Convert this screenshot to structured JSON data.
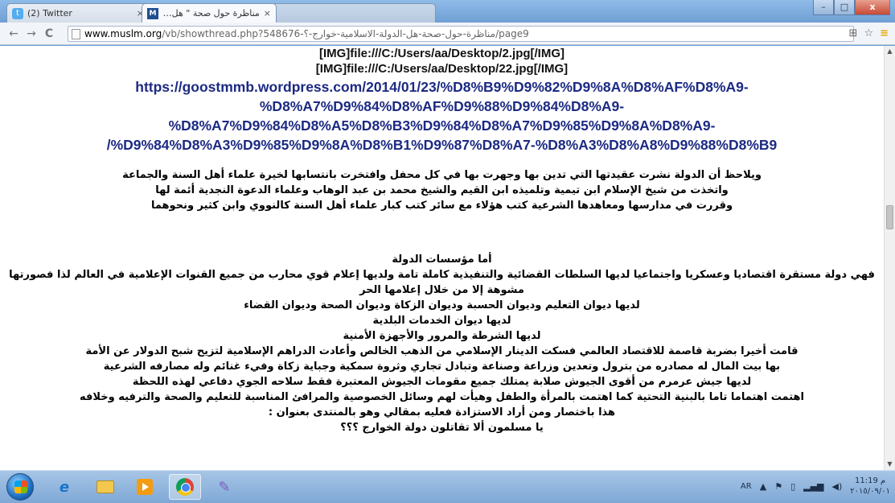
{
  "tabs": [
    {
      "title": "(2) Twitter",
      "close": "×"
    },
    {
      "title": "مناظرة حول صحة \" هل الدولة الا",
      "close": "×"
    },
    {
      "title": "",
      "close": ""
    }
  ],
  "window_controls": {
    "minimize": "–",
    "maximize": "□",
    "close": "x"
  },
  "toolbar": {
    "back": "←",
    "forward": "→",
    "reload": "C"
  },
  "address": {
    "host": "www.muslm.org",
    "path": "/vb/showthread.php?548676-مناظرة-حول-صحة-هل-الدولة-الاسلامية-خوارج-؟/page9"
  },
  "content": {
    "img_lines": [
      "[IMG]file:///C:/Users/aa/Desktop/2.jpg[/IMG]",
      "[IMG]file:///C:/Users/aa/Desktop/22.jpg[/IMG]"
    ],
    "url_lines": [
      "https://goostmmb.wordpress.com/2014/01/23/%D8%B9%D9%82%D9%8A%D8%AF%D8%A9-",
      "%D8%A7%D9%84%D8%AF%D9%88%D9%84%D8%A9-",
      "%D8%A7%D9%84%D8%A5%D8%B3%D9%84%D8%A7%D9%85%D9%8A%D8%A9-",
      "/%D9%84%D8%A3%D9%85%D9%8A%D8%B1%D9%87%D8%A7-%D8%A3%D8%A8%D9%88%D8%B9"
    ],
    "paragraph1": [
      "ويلاحظ أن الدولة نشرت عقيدتها التي تدين بها وجهرت بها في كل محفل وافتخرت بانتسابها لخيرة علماء أهل السنة والجماعة",
      "واتخذت من شيخ الإسلام ابن تيمية وتلميذه ابن القيم والشيخ محمد بن عبد الوهاب وعلماء الدعوة النجدية أئمة لها",
      "وقررت في مدارسها ومعاهدها الشرعية كتب هؤلاء مع سائر كتب كبار علماء أهل السنة كالنووي وابن كثير ونحوهما"
    ],
    "paragraph2": [
      "أما مؤسسات الدولة",
      "فهي دولة مستقرة اقتصاديا وعسكريا واجتماعيا لديها السلطات القضائية والتنفيذية كاملة تامة ولديها إعلام قوي محارب من جميع القنوات الإعلامية في العالم لذا فصورتها",
      "مشوهة إلا من خلال إعلامها الحر",
      "لديها ديوان التعليم وديوان الحسبة وديوان الزكاة وديوان الصحة وديوان القضاء",
      "لديها ديوان الخدمات البلدية",
      "لديها الشرطة والمرور والأجهزة الأمنية",
      "قامت أخيرا بضربة قاصمة للاقتصاد العالمي فسكت الدينار الإسلامي من الذهب الخالص وأعادت الدراهم الإسلامية لتزيح شبح الدولار عن الأمة",
      "بها بيت المال له مصادره من بترول وتعدين وزراعة وصناعة وتبادل تجاري وثروة سمكية وجباية زكاة وفيء غنائم وله مصارفه الشرعية",
      "لديها جيش عرمرم من أقوى الجيوش صلابة يمتلك جميع مقومات الجيوش المعتبرة فقط سلاحه الجوي دفاعي لهذه اللحظة",
      "اهتمت اهتماما تاما بالبنية التحتية كما اهتمت بالمرأة والطفل وهيأت لهم وسائل الخصوصية والمرافئ المناسبة للتعليم والصحة والترفيه وخلافه",
      "هذا باختصار ومن أراد الاستزادة فعليه بمقالي وهو بالمنتدى بعنوان :",
      "يا مسلمون ألا تقاتلون دولة الخوارج ؟؟؟"
    ]
  },
  "taskbar": {
    "tray_lang": "AR",
    "clock_time": "11:19 م",
    "clock_date": "٢٠١٥/٠٩/٠١"
  },
  "colors": {
    "link": "#1c2a83",
    "taskbar": "#8fb3dd",
    "title_bar": "#7faad9"
  }
}
